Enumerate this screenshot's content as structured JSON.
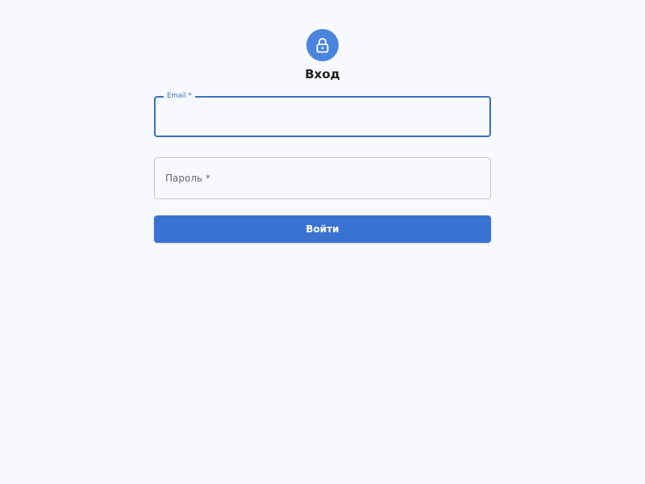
{
  "header": {
    "icon": "lock-icon",
    "title": "Вход"
  },
  "form": {
    "email": {
      "label": "Email *",
      "value": ""
    },
    "password": {
      "label": "Пароль *",
      "value": ""
    },
    "submit_label": "Войти"
  },
  "colors": {
    "accent": "#3a72d1",
    "avatar_bg": "#4a84dd",
    "background": "#f7f9fd"
  }
}
